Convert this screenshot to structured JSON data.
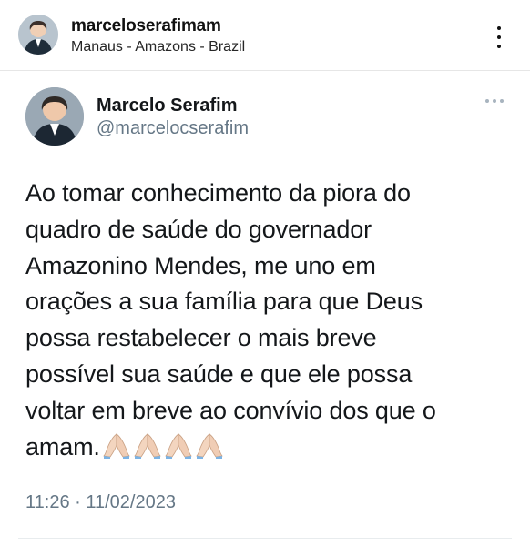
{
  "instagram_header": {
    "username": "marceloserafimam",
    "location": "Manaus - Amazons - Brazil",
    "avatar_icon": "profile-photo-avatar",
    "more_icon": "vertical-ellipsis-icon"
  },
  "tweet": {
    "display_name": "Marcelo Serafim",
    "handle": "@marcelocserafim",
    "avatar_icon": "profile-photo-avatar",
    "more_icon": "horizontal-ellipsis-icon",
    "text_lines": [
      "Ao tomar conhecimento da piora do",
      "quadro de saúde do governador",
      "Amazonino Mendes, me uno em",
      "orações a sua família para que Deus",
      "possa restabelecer o mais breve",
      "possível sua saúde e que ele possa",
      "voltar em breve ao convívio dos que o",
      "amam."
    ],
    "emoji": [
      "🙏🏻",
      "🙏🏻",
      "🙏🏻",
      "🙏🏻"
    ],
    "emoji_icon": "praying-hands-icon",
    "timestamp": "11:26 · 11/02/2023"
  },
  "colors": {
    "text_primary": "#14171a",
    "text_secondary": "#657786",
    "divider": "#e6e6e6",
    "more_dots": "#a8b4bf"
  }
}
